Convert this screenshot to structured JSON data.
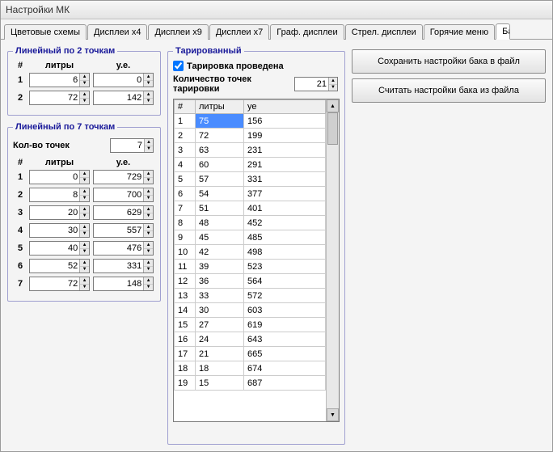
{
  "window": {
    "title": "Настройки МК"
  },
  "tabs": [
    "Цветовые схемы",
    "Дисплеи x4",
    "Дисплеи x9",
    "Дисплеи x7",
    "Граф. дисплеи",
    "Стрел. дисплеи",
    "Горячие меню",
    "Ба"
  ],
  "linear2": {
    "legend": "Линейный по 2 точкам",
    "head_num": "#",
    "head_litry": "литры",
    "head_ue": "у.е.",
    "rows": [
      {
        "n": "1",
        "litry": "6",
        "ue": "0"
      },
      {
        "n": "2",
        "litry": "72",
        "ue": "142"
      }
    ]
  },
  "linear7": {
    "legend": "Линейный по 7 точкам",
    "kolvo_label": "Кол-во точек",
    "kolvo_value": "7",
    "head_num": "#",
    "head_litry": "литры",
    "head_ue": "у.е.",
    "rows": [
      {
        "n": "1",
        "litry": "0",
        "ue": "729"
      },
      {
        "n": "2",
        "litry": "8",
        "ue": "700"
      },
      {
        "n": "3",
        "litry": "20",
        "ue": "629"
      },
      {
        "n": "4",
        "litry": "30",
        "ue": "557"
      },
      {
        "n": "5",
        "litry": "40",
        "ue": "476"
      },
      {
        "n": "6",
        "litry": "52",
        "ue": "331"
      },
      {
        "n": "7",
        "litry": "72",
        "ue": "148"
      }
    ]
  },
  "tarrir": {
    "legend": "Тарированный",
    "checkbox_label": "Тарировка проведена",
    "checkbox_checked": true,
    "kolvo_label": "Количество точек тарировки",
    "kolvo_value": "21",
    "th_n": "#",
    "th_litry": "литры",
    "th_ue": "уе",
    "rows": [
      {
        "n": "1",
        "litry": "75",
        "ue": "156"
      },
      {
        "n": "2",
        "litry": "72",
        "ue": "199"
      },
      {
        "n": "3",
        "litry": "63",
        "ue": "231"
      },
      {
        "n": "4",
        "litry": "60",
        "ue": "291"
      },
      {
        "n": "5",
        "litry": "57",
        "ue": "331"
      },
      {
        "n": "6",
        "litry": "54",
        "ue": "377"
      },
      {
        "n": "7",
        "litry": "51",
        "ue": "401"
      },
      {
        "n": "8",
        "litry": "48",
        "ue": "452"
      },
      {
        "n": "9",
        "litry": "45",
        "ue": "485"
      },
      {
        "n": "10",
        "litry": "42",
        "ue": "498"
      },
      {
        "n": "11",
        "litry": "39",
        "ue": "523"
      },
      {
        "n": "12",
        "litry": "36",
        "ue": "564"
      },
      {
        "n": "13",
        "litry": "33",
        "ue": "572"
      },
      {
        "n": "14",
        "litry": "30",
        "ue": "603"
      },
      {
        "n": "15",
        "litry": "27",
        "ue": "619"
      },
      {
        "n": "16",
        "litry": "24",
        "ue": "643"
      },
      {
        "n": "17",
        "litry": "21",
        "ue": "665"
      },
      {
        "n": "18",
        "litry": "18",
        "ue": "674"
      },
      {
        "n": "19",
        "litry": "15",
        "ue": "687"
      }
    ]
  },
  "buttons": {
    "save": "Сохранить настройки бака в файл",
    "load": "Считать настройки бака из файла"
  }
}
